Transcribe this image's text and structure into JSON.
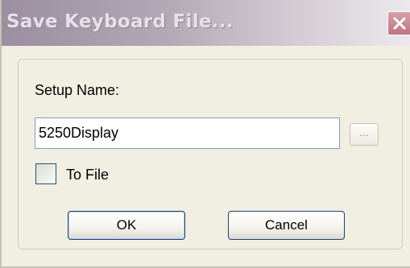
{
  "window": {
    "title": "Save Keyboard File...",
    "close_icon": "close-icon"
  },
  "form": {
    "setup_name_label": "Setup Name:",
    "setup_name_value": "5250Display",
    "browse_label": "...",
    "to_file_label": "To File",
    "to_file_checked": false
  },
  "buttons": {
    "ok_label": "OK",
    "cancel_label": "Cancel"
  }
}
